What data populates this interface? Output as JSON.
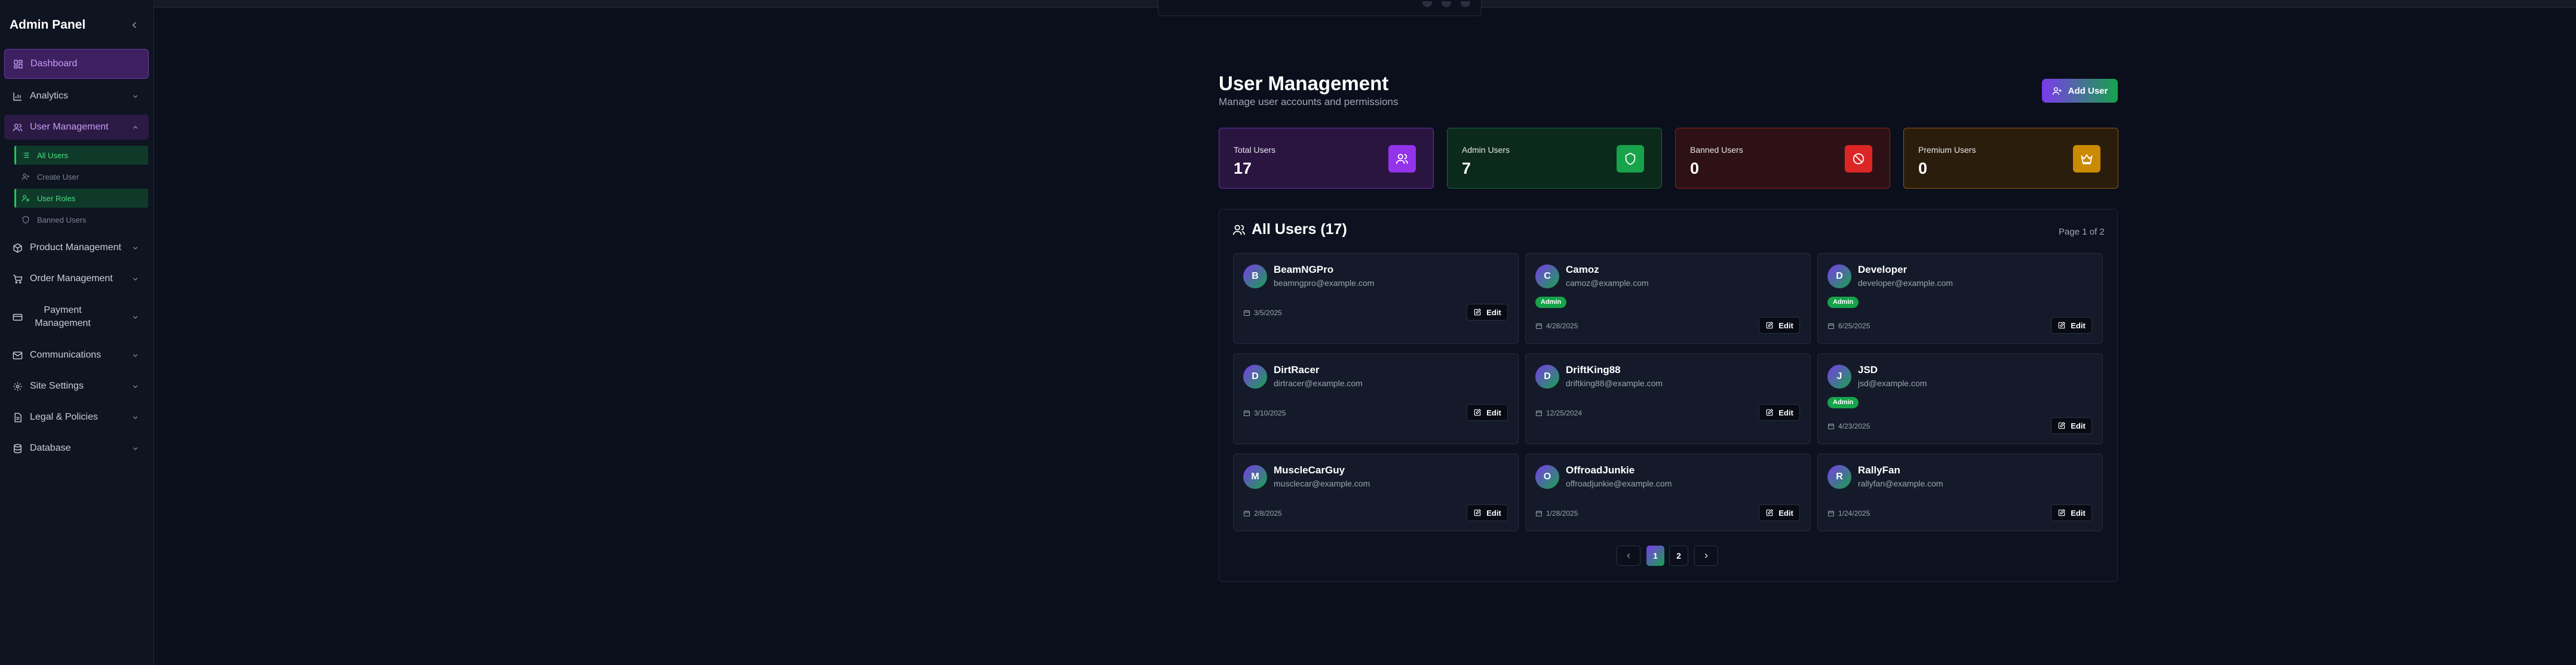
{
  "sidebar": {
    "title": "Admin Panel",
    "items": [
      {
        "label": "Dashboard",
        "icon": "layout-dashboard-icon"
      },
      {
        "label": "Analytics",
        "icon": "bar-chart-icon"
      },
      {
        "label": "User Management",
        "icon": "users-icon"
      },
      {
        "label": "Product Management",
        "icon": "package-icon"
      },
      {
        "label": "Order Management",
        "icon": "shopping-cart-icon"
      },
      {
        "label": "Payment Management",
        "icon": "credit-card-icon"
      },
      {
        "label": "Communications",
        "icon": "mail-icon"
      },
      {
        "label": "Site Settings",
        "icon": "gear-icon"
      },
      {
        "label": "Legal & Policies",
        "icon": "file-text-icon"
      },
      {
        "label": "Database",
        "icon": "database-icon"
      }
    ],
    "user_submenu": [
      {
        "label": "All Users"
      },
      {
        "label": "Create User"
      },
      {
        "label": "User Roles"
      },
      {
        "label": "Banned Users"
      }
    ]
  },
  "header": {
    "title": "User Management",
    "subtitle": "Manage user accounts and permissions",
    "add_button": "Add User"
  },
  "stats": [
    {
      "label": "Total Users",
      "value": "17",
      "color": "#9333ea"
    },
    {
      "label": "Admin Users",
      "value": "7",
      "color": "#16a34a"
    },
    {
      "label": "Banned Users",
      "value": "0",
      "color": "#dc2626"
    },
    {
      "label": "Premium Users",
      "value": "0",
      "color": "#ca8a04"
    }
  ],
  "users_panel": {
    "title": "All Users (17)",
    "page_info": "Page 1 of 2",
    "edit_label": "Edit",
    "users": [
      {
        "initial": "B",
        "name": "BeamNGPro",
        "email": "beamngpro@example.com",
        "date": "3/5/2025",
        "badge": ""
      },
      {
        "initial": "C",
        "name": "Camoz",
        "email": "camoz@example.com",
        "date": "4/28/2025",
        "badge": "Admin"
      },
      {
        "initial": "D",
        "name": "Developer",
        "email": "developer@example.com",
        "date": "6/25/2025",
        "badge": "Admin"
      },
      {
        "initial": "D",
        "name": "DirtRacer",
        "email": "dirtracer@example.com",
        "date": "3/10/2025",
        "badge": ""
      },
      {
        "initial": "D",
        "name": "DriftKing88",
        "email": "driftking88@example.com",
        "date": "12/25/2024",
        "badge": ""
      },
      {
        "initial": "J",
        "name": "JSD",
        "email": "jsd@example.com",
        "date": "4/23/2025",
        "badge": "Admin"
      },
      {
        "initial": "M",
        "name": "MuscleCarGuy",
        "email": "musclecar@example.com",
        "date": "2/8/2025",
        "badge": ""
      },
      {
        "initial": "O",
        "name": "OffroadJunkie",
        "email": "offroadjunkie@example.com",
        "date": "1/28/2025",
        "badge": ""
      },
      {
        "initial": "R",
        "name": "RallyFan",
        "email": "rallyfan@example.com",
        "date": "1/24/2025",
        "badge": ""
      }
    ]
  },
  "pagination": {
    "pages": [
      "1",
      "2"
    ],
    "current": "1"
  }
}
